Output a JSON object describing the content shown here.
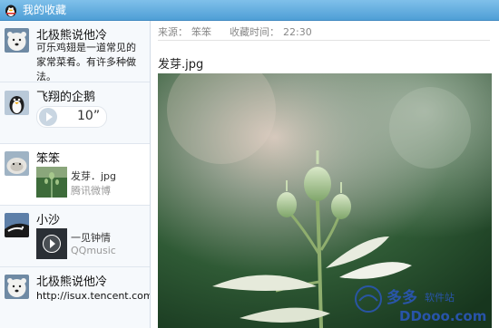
{
  "window": {
    "title": "我的收藏"
  },
  "favorites": [
    {
      "name": "北极熊说他冷",
      "snippet": "可乐鸡翅是一道常见的家常菜肴。有许多种做法。"
    },
    {
      "name": "飞翔的企鹅",
      "voice_duration": "10”"
    },
    {
      "name": "笨笨",
      "subtitle": "发芽．jpg",
      "source": "腾讯微博"
    },
    {
      "name": "小沙",
      "subtitle": "一见钟情",
      "source": "QQmusic"
    },
    {
      "name": "北极熊说他冷",
      "url": "http://isux.tencent.com/"
    }
  ],
  "detail": {
    "source_label": "来源：",
    "source_value": "笨笨",
    "time_label": "收藏时间：",
    "time_value": "22:30",
    "file_title": "发芽.jpg"
  },
  "watermark": {
    "text1": "多多",
    "text2": "软件站",
    "text3": "DDooo.com"
  },
  "colors": {
    "titlebar": "#5aa8dc",
    "sidebar_bg": "#f6f9fc",
    "selected_bg": "#ffffff",
    "watermark": "#2a57b8"
  }
}
